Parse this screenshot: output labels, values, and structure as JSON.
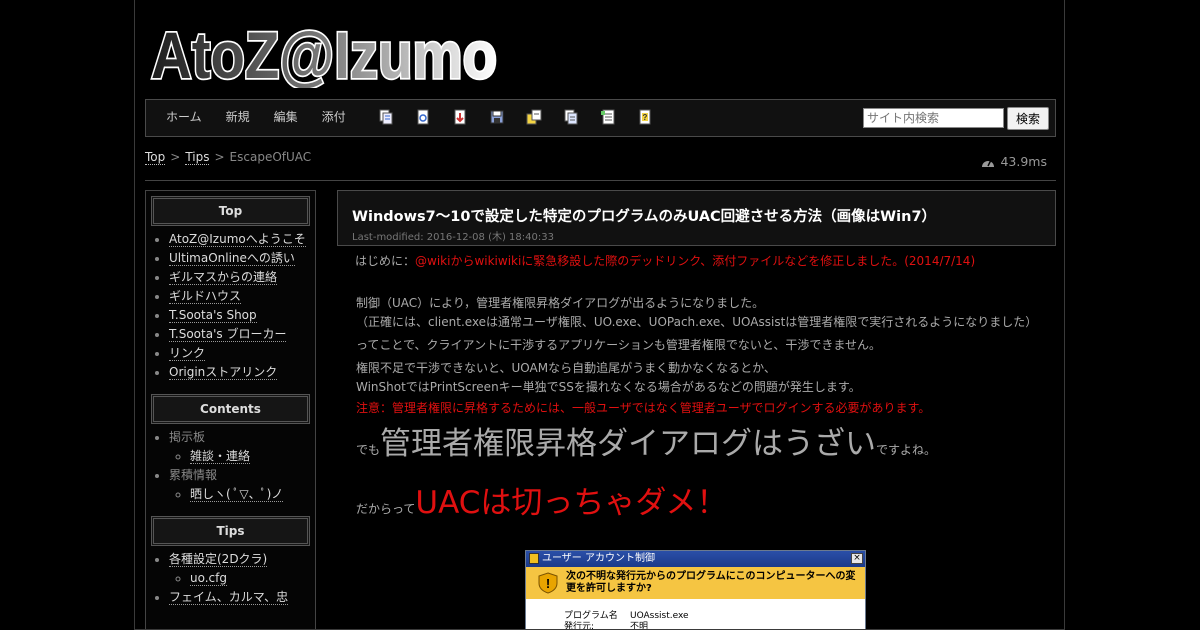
{
  "logo": {
    "text": "AtoZ@Izumo"
  },
  "nav": {
    "menu": [
      "ホーム",
      "新規",
      "編集",
      "添付"
    ],
    "tool_icons": [
      "page-copy-icon",
      "page-diff-icon",
      "page-backup-icon",
      "page-save-icon",
      "page-rename-icon",
      "page-list-icon",
      "recent-changes-icon",
      "help-icon"
    ]
  },
  "search": {
    "placeholder": "サイト内検索",
    "button": "検索"
  },
  "breadcrumb": {
    "top": "Top",
    "sep": ">",
    "tips": "Tips",
    "current": "EscapeOfUAC"
  },
  "timing": "43.9ms",
  "sidebar": {
    "top_title": "Top",
    "top_items": [
      "AtoZ@Izumoへようこそ",
      "UltimaOnlineへの誘い",
      "ギルマスからの連絡",
      "ギルドハウス",
      "T.Soota's Shop",
      "T.Soota's ブローカー",
      "リンク",
      "Originストアリンク"
    ],
    "contents_title": "Contents",
    "board": "掲示板",
    "board_child": "雑談・連絡",
    "stats": "累積情報",
    "stats_child": "晒しヽ( ﾟ▽、ﾟ)ノ",
    "tips_title": "Tips",
    "tips_item1": "各種設定(2Dクラ)",
    "tips_child": "uo.cfg",
    "tips_item2": "フェイム、カルマ、忠"
  },
  "article": {
    "title": "Windows7～10で設定した特定のプログラムのみUAC回避させる方法（画像はWin7）",
    "modified": "Last-modified: 2016-12-08 (木) 18:40:33",
    "intro_label": "はじめに：",
    "intro_red": "@wikiからwikiwikiに緊急移設した際のデッドリンク、添付ファイルなどを修正しました。(2014/7/14)",
    "p1": "制御（UAC）により，管理者権限昇格ダイアログが出るようになりました。",
    "p2": "（正確には、client.exeは通常ユーザ権限、UO.exe、UOPach.exe、UOAssistは管理者権限で実行されるようになりました）",
    "p3": "ってことで、クライアントに干渉するアプリケーションも管理者権限でないと、干渉できません。",
    "p4": "権限不足で干渉できないと、UOAMなら自動追尾がうまく動かなくなるとか、",
    "p5": "WinShotではPrintScreenキー単独でSSを撮れなくなる場合があるなどの問題が発生します。",
    "note": "注意：管理者権限に昇格するためには、一般ユーザではなく管理者ユーザでログインする必要があります。",
    "l1_pre": "でも",
    "l1_big": "管理者権限昇格ダイアログはうざい",
    "l1_post": "ですよね。",
    "l2_pre": "だからって",
    "l2_big": "UACは切っちゃダメ！"
  },
  "dialog": {
    "title": "ユーザー アカウント制御",
    "question": "次の不明な発行元からのプログラムにこのコンピューターへの変更を許可しますか?",
    "program_key": "プログラム名",
    "program_val": "UOAssist.exe",
    "publisher_key": "発行元:",
    "publisher_val": "不明"
  }
}
